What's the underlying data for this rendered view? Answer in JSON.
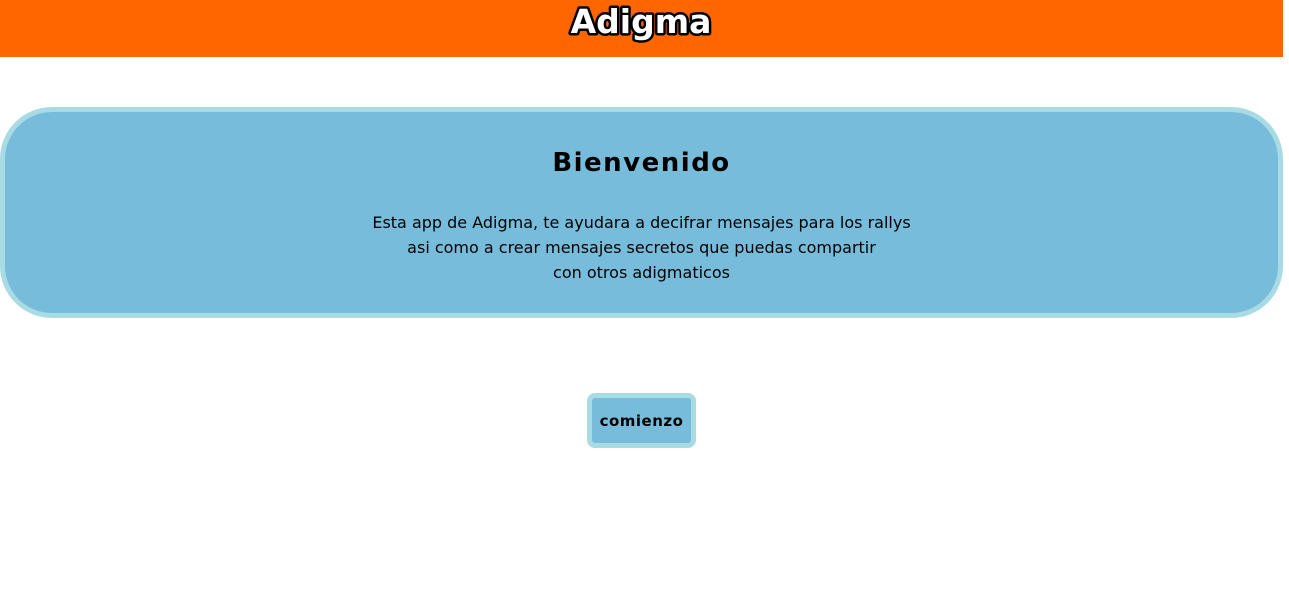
{
  "header": {
    "logo_text": "Adigma"
  },
  "welcome": {
    "title": "Bienvenido",
    "lines": [
      "Esta app de Adigma, te ayudara a decifrar mensajes para los rallys",
      "asi como a crear mensajes secretos que puedas compartir",
      "con otros adigmaticos"
    ]
  },
  "start_button": {
    "label": "comienzo"
  },
  "colors": {
    "header_background": "#ff6600",
    "card_background": "#77bddb",
    "card_border": "#a9dbe4"
  }
}
